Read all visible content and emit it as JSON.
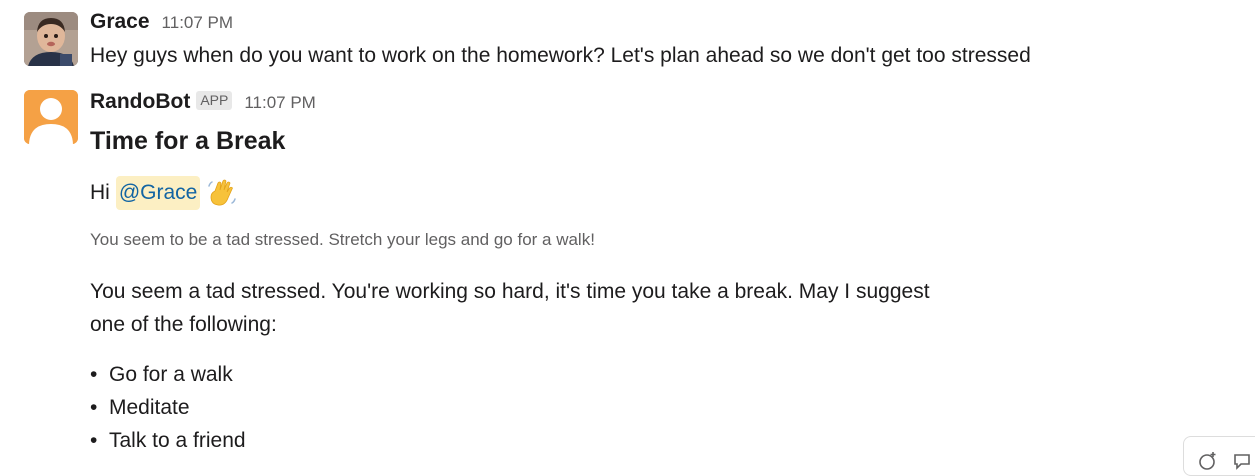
{
  "messages": {
    "grace": {
      "sender": "Grace",
      "time": "11:07 PM",
      "text": "Hey guys when do you want to work on the homework? Let's plan ahead so we don't get too stressed",
      "avatar_icon": "user-photo-avatar"
    },
    "bot": {
      "sender": "RandoBot",
      "badge": "APP",
      "time": "11:07 PM",
      "avatar_icon": "default-user-avatar-icon",
      "avatar_color": "#f5a145",
      "title": "Time for a Break",
      "greeting_prefix": "Hi",
      "mention": "@Grace",
      "emoji": "waving-hand-emoji",
      "context": "You seem to be a tad stressed. Stretch your legs and go for a walk!",
      "paragraph_line1": "You seem a tad stressed. You're working so hard, it's time you take a break. May I suggest",
      "paragraph_line2": "one of the following:",
      "suggestions": [
        "Go for a walk",
        "Meditate",
        "Talk to a friend"
      ]
    }
  },
  "toolbar": {
    "icons": [
      "add-reaction-icon",
      "thread-icon"
    ]
  },
  "colors": {
    "text": "#1d1c1d",
    "muted": "#616061",
    "mention_bg": "#fcefc3",
    "mention_text": "#1264a3"
  }
}
